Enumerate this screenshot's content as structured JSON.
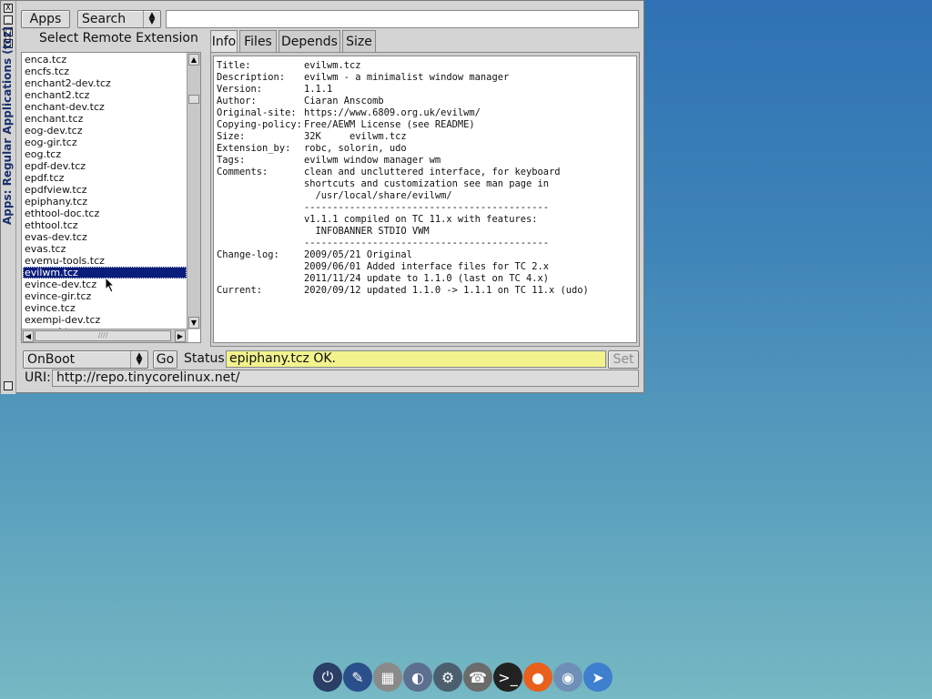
{
  "window": {
    "title": "Apps: Regular Applications (tcz)",
    "controls": [
      "X",
      "_",
      "□",
      "□"
    ]
  },
  "toolbar": {
    "apps_label": "Apps",
    "mode_select": "Search",
    "search_value": ""
  },
  "left": {
    "heading": "Select Remote Extension",
    "items": [
      "enca.tcz",
      "encfs.tcz",
      "enchant2-dev.tcz",
      "enchant2.tcz",
      "enchant-dev.tcz",
      "enchant.tcz",
      "eog-dev.tcz",
      "eog-gir.tcz",
      "eog.tcz",
      "epdf-dev.tcz",
      "epdf.tcz",
      "epdfview.tcz",
      "epiphany.tcz",
      "ethtool-doc.tcz",
      "ethtool.tcz",
      "evas-dev.tcz",
      "evas.tcz",
      "evemu-tools.tcz",
      "evilwm.tcz",
      "evince-dev.tcz",
      "evince-gir.tcz",
      "evince.tcz",
      "exempi-dev.tcz",
      "exempi.tcz"
    ],
    "selected_item": "evilwm.tcz"
  },
  "tabs": [
    "Info",
    "Files",
    "Depends",
    "Size"
  ],
  "info": {
    "rows": [
      {
        "k": "Title:",
        "v": "evilwm.tcz"
      },
      {
        "k": "Description:",
        "v": "evilwm - a minimalist window manager"
      },
      {
        "k": "Version:",
        "v": "1.1.1"
      },
      {
        "k": "Author:",
        "v": "Ciaran Anscomb"
      },
      {
        "k": "Original-site:",
        "v": "https://www.6809.org.uk/evilwm/"
      },
      {
        "k": "Copying-policy:",
        "v": "Free/AEWM License (see README)"
      },
      {
        "k": "Size:",
        "v": "32K     evilwm.tcz"
      },
      {
        "k": "Extension_by:",
        "v": "robc, solorin, udo"
      },
      {
        "k": "Tags:",
        "v": "evilwm window manager wm"
      },
      {
        "k": "Comments:",
        "v": "clean and uncluttered interface, for keyboard"
      },
      {
        "k": "",
        "v": "shortcuts and customization see man page in"
      },
      {
        "k": "",
        "v": "  /usr/local/share/evilwm/"
      },
      {
        "k": "",
        "v": "-------------------------------------------"
      },
      {
        "k": "",
        "v": "v1.1.1 compiled on TC 11.x with features:"
      },
      {
        "k": "",
        "v": "  INFOBANNER STDIO VWM"
      },
      {
        "k": "",
        "v": "-------------------------------------------"
      },
      {
        "k": "Change-log:",
        "v": "2009/05/21 Original"
      },
      {
        "k": "",
        "v": "2009/06/01 Added interface files for TC 2.x"
      },
      {
        "k": "",
        "v": "2011/11/24 update to 1.1.0 (last on TC 4.x)"
      },
      {
        "k": "Current:",
        "v": "2020/09/12 updated 1.1.0 -> 1.1.1 on TC 11.x (udo)"
      }
    ]
  },
  "bottom": {
    "load_select": "OnBoot",
    "go_label": "Go",
    "status_label": "Status",
    "status_value": "epiphany.tcz OK.",
    "set_label": "Set",
    "uri_label": "URI:",
    "uri_value": "http://repo.tinycorelinux.net/"
  },
  "dock": [
    {
      "name": "exit-icon",
      "glyph": "⏻",
      "color": "#2a3e66"
    },
    {
      "name": "paint-icon",
      "glyph": "✎",
      "color": "#2b4f8a"
    },
    {
      "name": "control-panel-icon",
      "glyph": "▦",
      "color": "#8a8a8a"
    },
    {
      "name": "mount-tool-icon",
      "glyph": "◐",
      "color": "#5d6f8f"
    },
    {
      "name": "apps-run-icon",
      "glyph": "⚙",
      "color": "#4b5f6e"
    },
    {
      "name": "network-icon",
      "glyph": "☎",
      "color": "#6b6b6b"
    },
    {
      "name": "terminal-icon",
      "glyph": ">_",
      "color": "#222222"
    },
    {
      "name": "firefox-icon",
      "glyph": "●",
      "color": "#e8601c"
    },
    {
      "name": "chrome-icon",
      "glyph": "◉",
      "color": "#6e8fb8"
    },
    {
      "name": "launcher-icon",
      "glyph": "➤",
      "color": "#3e7fd0"
    }
  ]
}
